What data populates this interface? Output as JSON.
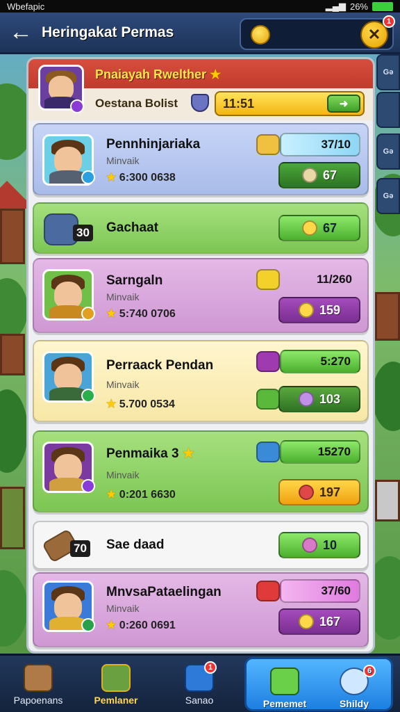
{
  "status_bar": {
    "left_text": "Wbefapic",
    "battery": "26%"
  },
  "header": {
    "back_label": "←",
    "title": "Heringakat Permas",
    "close_label": "✕",
    "close_badge": "1"
  },
  "rail": [
    "Gǝ",
    "",
    "Gǝ",
    "Gǝ"
  ],
  "player": {
    "name": "Pnaiayah Rwelther",
    "subtitle": "Oestana Bolist",
    "bar_value": "11:51",
    "bar_button": "➜"
  },
  "rows": [
    {
      "name": "Pennhinjariaka",
      "sub": "Minvaik",
      "stats": "6:300  0638",
      "value": "37/10",
      "button": "67",
      "level": ""
    },
    {
      "name": "Gachaat",
      "sub": "",
      "stats": "",
      "value": "",
      "button": "67",
      "level": "30"
    },
    {
      "name": "Sarngaln",
      "sub": "Minvaik",
      "stats": "5:740  0706",
      "value": "11/260",
      "button": "159",
      "level": ""
    },
    {
      "name": "Perraack Pendan",
      "sub": "Minvaik",
      "stats": "5.700  0534",
      "value": "5:270",
      "button": "103",
      "level": ""
    },
    {
      "name": "Penmaika",
      "sub": "Minvaik",
      "stats": "0:201  6630",
      "value": "15270",
      "button": "197",
      "level": ""
    },
    {
      "name": "Sae daad",
      "sub": "",
      "stats": "",
      "value": "",
      "button": "10",
      "level": "70"
    },
    {
      "name": "MnvsaPataelingan",
      "sub": "Minvaik",
      "stats": "0:260  0691",
      "value": "37/60",
      "button": "167",
      "level": ""
    }
  ],
  "row_star": "★",
  "row3_extra": "3",
  "bottom_nav": [
    {
      "label": "Papoenans",
      "icon": "scroll-icon"
    },
    {
      "label": "Pemlaner",
      "icon": "map-icon"
    },
    {
      "label": "Sanao",
      "icon": "camera-icon",
      "badge": "1"
    },
    {
      "label": "Pememet",
      "icon": "leaf-icon"
    },
    {
      "label": "Shildy",
      "icon": "globe-icon",
      "badge": "6"
    }
  ],
  "colors": {
    "row_blue": "#b8c8f0",
    "row_green": "#8fd06a",
    "row_purple": "#d9a6dc",
    "row_cream": "#fbf1c4",
    "row_white": "#f5f5f5",
    "btn_green": "#3f9a2c",
    "btn_purple": "#8b3ea0",
    "btn_yellow": "#f0b20f"
  }
}
